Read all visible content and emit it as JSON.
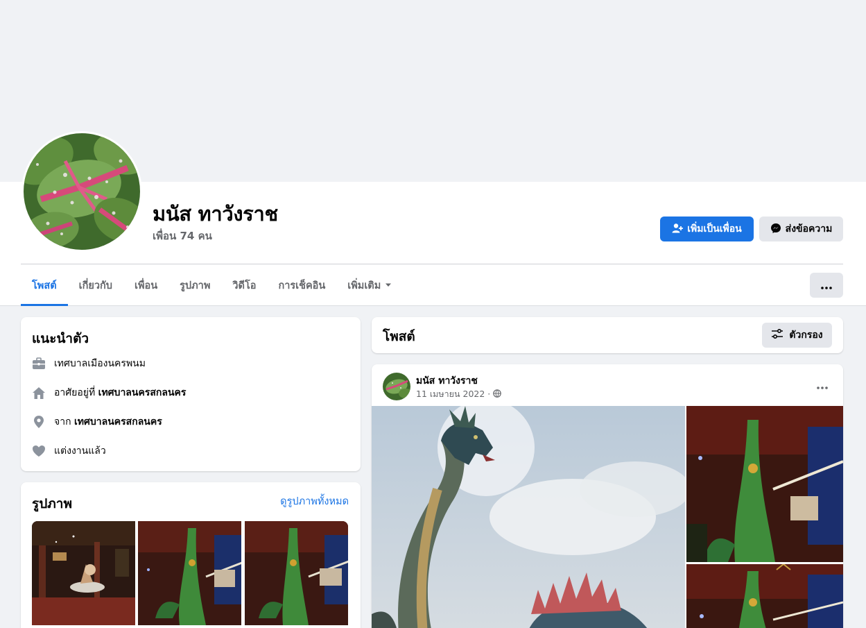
{
  "profile": {
    "name": "มนัส ทาวังราช",
    "friends_text": "เพื่อน 74 คน",
    "avatar_icon": "leaf-photo"
  },
  "actions": {
    "add_friend": "เพิ่มเป็นเพื่อน",
    "message": "ส่งข้อความ"
  },
  "tabs": [
    {
      "label": "โพสต์",
      "active": true
    },
    {
      "label": "เกี่ยวกับ",
      "active": false
    },
    {
      "label": "เพื่อน",
      "active": false
    },
    {
      "label": "รูปภาพ",
      "active": false
    },
    {
      "label": "วิดีโอ",
      "active": false
    },
    {
      "label": "การเช็คอิน",
      "active": false
    },
    {
      "label": "เพิ่มเติม",
      "active": false
    }
  ],
  "intro": {
    "title": "แนะนำตัว",
    "items": [
      {
        "icon": "briefcase-icon",
        "text": "เทศบาลเมืองนครพนม",
        "bold": ""
      },
      {
        "icon": "home-icon",
        "text": "อาศัยอยู่ที่ ",
        "bold": "เทศบาลนครสกลนคร"
      },
      {
        "icon": "location-pin-icon",
        "text": "จาก ",
        "bold": "เทศบาลนครสกลนคร"
      },
      {
        "icon": "heart-icon",
        "text": "แต่งงานแล้ว",
        "bold": ""
      }
    ]
  },
  "photos": {
    "title": "รูปภาพ",
    "see_all": "ดูรูปภาพทั้งหมด"
  },
  "posts": {
    "title": "โพสต์",
    "filter_label": "ตัวกรอง"
  },
  "post": {
    "author": "มนัส ทาวังราช",
    "date": "11 เมษายน 2022 ·",
    "privacy_icon": "globe-icon"
  },
  "colors": {
    "accent": "#1b74e4",
    "background": "#f0f2f5",
    "secondary_button": "#e4e6eb",
    "muted_text": "#65676b"
  }
}
